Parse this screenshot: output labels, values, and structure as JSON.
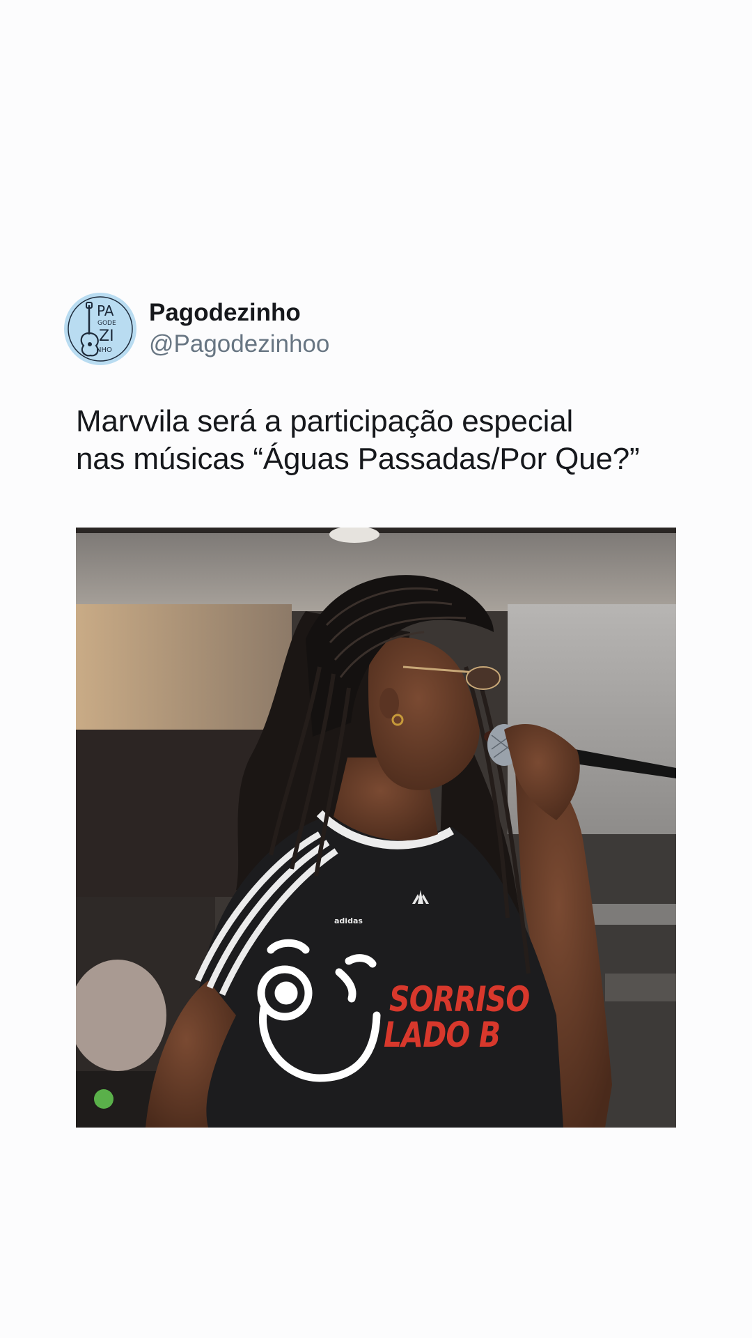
{
  "tweet": {
    "display_name": "Pagodezinho",
    "handle": "@Pagodezinhoo",
    "text_lines": [
      "Marvvila será a participação especial",
      "nas músicas “Águas Passadas/Por Que?”"
    ]
  },
  "avatar": {
    "logo_lines": [
      "PA",
      "GODE",
      "ZI",
      "NHO"
    ]
  },
  "media": {
    "overlay_brand_lines": [
      "SORRISO",
      "LADO B"
    ],
    "shirt_logo": "adidas",
    "brand_color": "#d8382c"
  },
  "icons": {
    "brand_mascot": "winking-face-icon",
    "avatar_logo": "guitar-icon"
  }
}
